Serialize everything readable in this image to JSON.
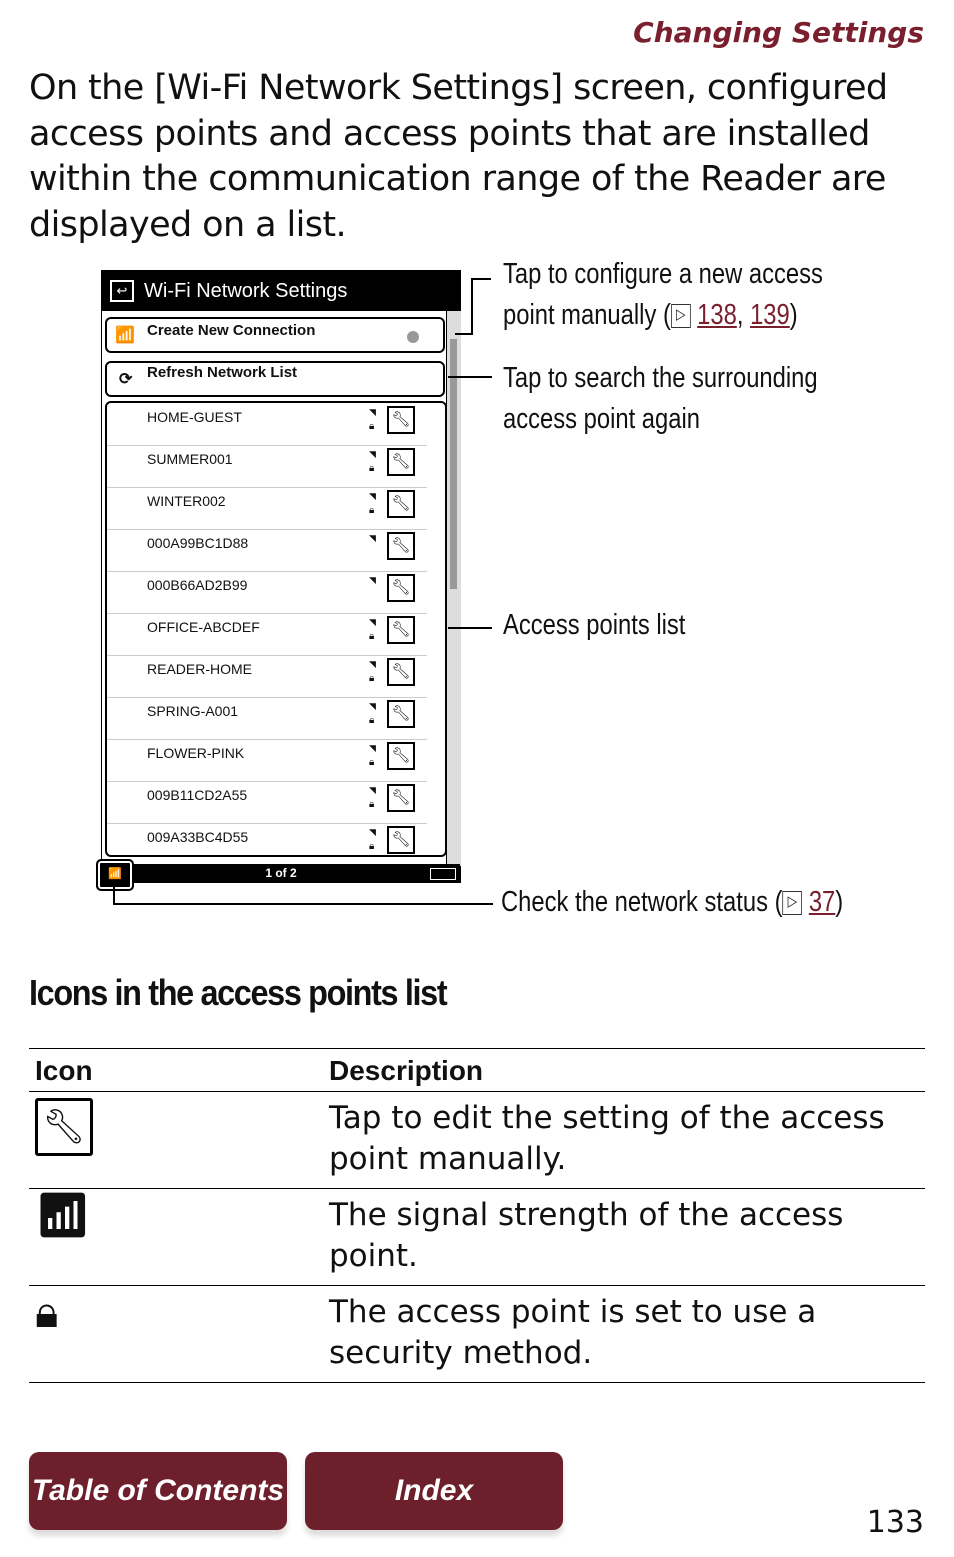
{
  "header": {
    "section": "Changing Settings"
  },
  "intro": "On the [Wi-Fi Network Settings] screen, configured access points and access points that are installed within the communication range of the Reader are displayed on a list.",
  "device": {
    "title": "Wi-Fi Network Settings",
    "create": "Create New Connection",
    "refresh": "Refresh Network List",
    "networks": [
      {
        "name": "HOME-GUEST",
        "locked": true
      },
      {
        "name": "SUMMER001",
        "locked": true
      },
      {
        "name": "WINTER002",
        "locked": true
      },
      {
        "name": "000A99BC1D88",
        "locked": false
      },
      {
        "name": "000B66AD2B99",
        "locked": false
      },
      {
        "name": "OFFICE-ABCDEF",
        "locked": true
      },
      {
        "name": "READER-HOME",
        "locked": true
      },
      {
        "name": "SPRING-A001",
        "locked": true
      },
      {
        "name": "FLOWER-PINK",
        "locked": true
      },
      {
        "name": "009B11CD2A55",
        "locked": true
      },
      {
        "name": "009A33BC4D55",
        "locked": true
      }
    ],
    "page": "1 of 2"
  },
  "callouts": {
    "create_1": "Tap to configure a new access",
    "create_2a": "point manually (",
    "ref1": "138",
    "sep": ",",
    "ref2": "139",
    "close": ")",
    "refresh_1": "Tap to search the surrounding",
    "refresh_2": "access point again",
    "list": "Access points list",
    "status_a": "Check the network status (",
    "ref3": "37"
  },
  "section": {
    "title": "Icons in the access points list",
    "headers": [
      "Icon",
      "Description"
    ],
    "rows": [
      {
        "icon": "wrench-icon",
        "desc": "Tap to edit the setting of the access point manually."
      },
      {
        "icon": "signal-icon",
        "desc": "The signal strength of the access point."
      },
      {
        "icon": "lock-icon",
        "desc": "The access point is set to use a security method."
      }
    ]
  },
  "nav": {
    "toc": "Table of Contents",
    "index": "Index"
  },
  "page_number": "133",
  "colors": {
    "accent": "#7a1f2e",
    "button": "#6e1f2c"
  }
}
